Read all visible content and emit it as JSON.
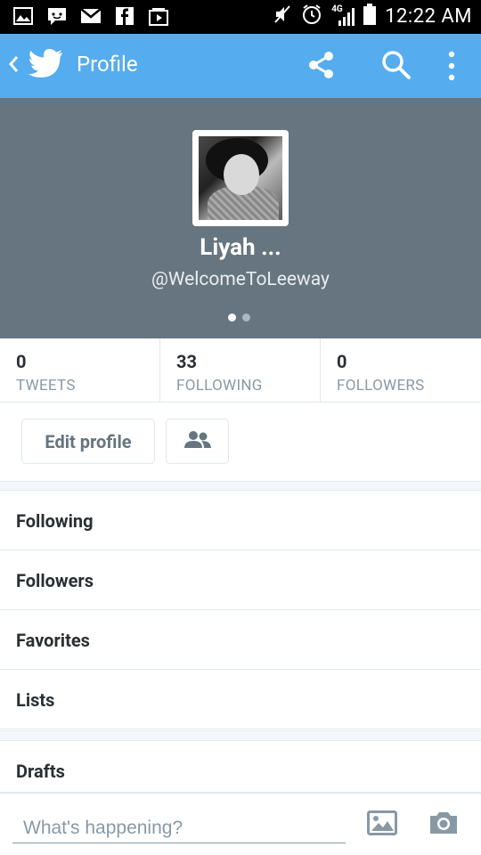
{
  "status_bar": {
    "time": "12:22 AM",
    "network": "4G",
    "icons": [
      "gallery-icon",
      "messenger-icon",
      "gmail-icon",
      "facebook-icon",
      "media-icon",
      "mute-icon",
      "alarm-icon",
      "signal-icon",
      "battery-icon"
    ]
  },
  "app_bar": {
    "title": "Profile",
    "icons": [
      "back-icon",
      "twitter-bird-icon",
      "share-icon",
      "search-icon",
      "more-icon"
    ],
    "color": "#55acee"
  },
  "profile": {
    "name": "Liyah ...",
    "handle": "@WelcomeToLeeway",
    "header_color": "#66757f"
  },
  "stats": [
    {
      "value": "0",
      "label": "TWEETS"
    },
    {
      "value": "33",
      "label": "FOLLOWING"
    },
    {
      "value": "0",
      "label": "FOLLOWERS"
    }
  ],
  "actions": {
    "edit_profile": "Edit profile",
    "people_icon": "people-icon"
  },
  "menu": {
    "following": "Following",
    "followers": "Followers",
    "favorites": "Favorites",
    "lists": "Lists",
    "drafts": "Drafts"
  },
  "compose": {
    "placeholder": "What's happening?"
  }
}
